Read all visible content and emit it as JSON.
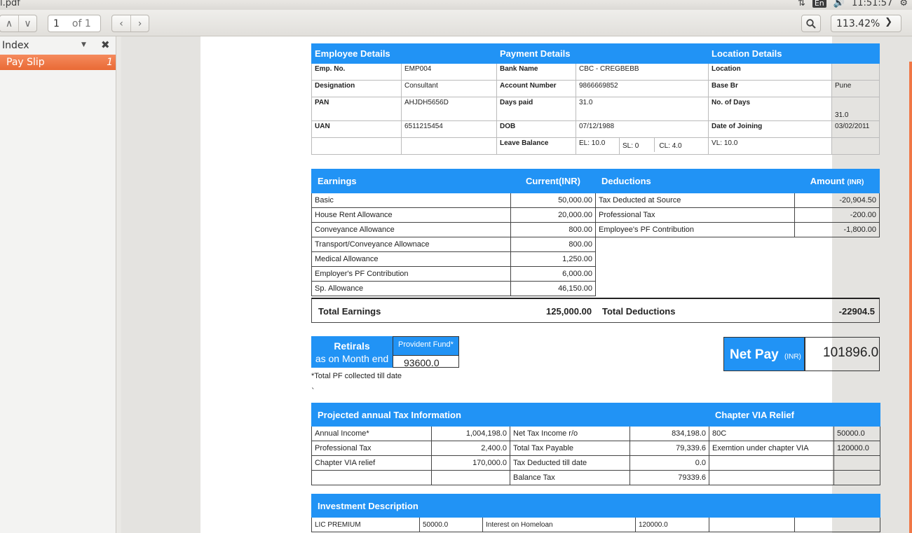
{
  "window": {
    "title": "l.pdf"
  },
  "tray": {
    "lang": "En",
    "time": "11:51:57"
  },
  "toolbar": {
    "page_value": "1",
    "page_of": "of 1",
    "zoom": "113.42%"
  },
  "sidebar": {
    "title": "Index",
    "items": [
      {
        "label": "Pay Slip",
        "page": "1"
      }
    ]
  },
  "employee": {
    "headers": {
      "employee": "Employee Details",
      "payment": "Payment Details",
      "location": "Location Details"
    },
    "rows": [
      [
        "Emp. No.",
        "EMP004",
        "Bank Name",
        "CBC - CREGBEBB",
        "Location",
        ""
      ],
      [
        "Designation",
        "Consultant",
        "Account Number",
        "9866669852",
        "Base Br",
        "Pune"
      ],
      [
        "PAN",
        "AHJDH5656D",
        "Days paid",
        "31.0",
        "No. of Days",
        "31.0"
      ],
      [
        "UAN",
        "6511215454",
        "DOB",
        "07/12/1988",
        "Date of Joining",
        "03/02/2011"
      ]
    ],
    "leave": {
      "label": "Leave Balance",
      "el": "EL: 10.0",
      "sl": "SL: 0",
      "cl": "CL: 4.0",
      "vl": "VL: 10.0"
    }
  },
  "earnings": {
    "headers": {
      "earnings": "Earnings",
      "current": "Current(INR)",
      "deductions": "Deductions",
      "amount": "Amount",
      "amount_unit": "(INR)"
    },
    "rows": [
      {
        "name": "Basic",
        "value": "50,000.00",
        "ded": "Tax Deducted at Source",
        "amt": "-20,904.50"
      },
      {
        "name": "House Rent Allowance",
        "value": "20,000.00",
        "ded": "Professional Tax",
        "amt": "-200.00"
      },
      {
        "name": "Conveyance Allowance",
        "value": "800.00",
        "ded": "Employee's PF Contribution",
        "amt": "-1,800.00"
      },
      {
        "name": "Transport/Conveyance Allownace",
        "value": "800.00"
      },
      {
        "name": "Medical Allowance",
        "value": "1,250.00"
      },
      {
        "name": "Employer's PF Contribution",
        "value": "6,000.00"
      },
      {
        "name": "Sp. Allowance",
        "value": "46,150.00"
      }
    ],
    "totals": {
      "earn_label": "Total Earnings",
      "earn_value": "125,000.00",
      "ded_label": "Total Deductions",
      "ded_value": "-22904.5"
    }
  },
  "retirals": {
    "title": "Retirals",
    "subtitle": "as on Month end",
    "pf_label": "Provident Fund*",
    "pf_value": "93600.0",
    "note": "*Total PF collected till date",
    "tick": "`"
  },
  "netpay": {
    "label": "Net Pay",
    "unit": "(INR)",
    "value": "101896.0"
  },
  "tax": {
    "headers": {
      "projected": "Projected annual Tax Information",
      "via": "Chapter VIA Relief"
    },
    "rows": [
      [
        "Annual Income*",
        "1,004,198.0",
        "Net Tax Income r/o",
        "834,198.0",
        "80C",
        "50000.0"
      ],
      [
        "Professional Tax",
        "2,400.0",
        "Total Tax Payable",
        "79,339.6",
        "Exemtion under chapter VIA",
        "120000.0"
      ],
      [
        "Chapter VIA relief",
        "170,000.0",
        "Tax Deducted till date",
        "0.0",
        "",
        ""
      ],
      [
        "",
        "",
        "Balance Tax",
        "79339.6",
        "",
        ""
      ]
    ]
  },
  "investment": {
    "header": "Investment Description",
    "rows": [
      [
        "LIC PREMIUM",
        "50000.0",
        "Interest on Homeloan",
        "120000.0",
        "",
        ""
      ]
    ]
  }
}
